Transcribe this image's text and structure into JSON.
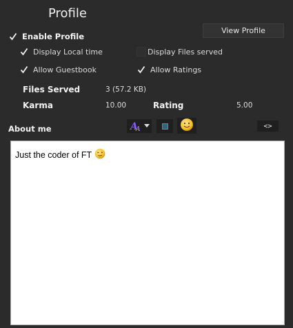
{
  "profile": {
    "title": "Profile",
    "view_button": "View Profile",
    "enable_profile": {
      "label": "Enable Profile",
      "checked": true
    },
    "options": [
      {
        "label": "Display Local time",
        "checked": true
      },
      {
        "label": "Display Files served",
        "checked": false
      },
      {
        "label": "Allow Guestbook",
        "checked": true
      },
      {
        "label": "Allow Ratings",
        "checked": true
      }
    ],
    "stats": {
      "files_served_label": "Files Served",
      "files_served_value": "3  (57.2 KB)",
      "karma_label": "Karma",
      "karma_value": "10.00",
      "rating_label": "Rating",
      "rating_value": "5.00"
    }
  },
  "about": {
    "label": "About me",
    "toolbar": {
      "font_icon": "font-color-icon",
      "color_icon": "color-square-icon",
      "emoji_icon": "smiley-icon",
      "source_label": "<>"
    },
    "text": "Just the coder of FT",
    "text_emoji": "wink-emoji"
  },
  "colors": {
    "background": "#2b2b2b",
    "font_icon_purple": "#8a5cff",
    "color_square": "#1f6f73",
    "emoji_yellow": "#f5c02a"
  }
}
